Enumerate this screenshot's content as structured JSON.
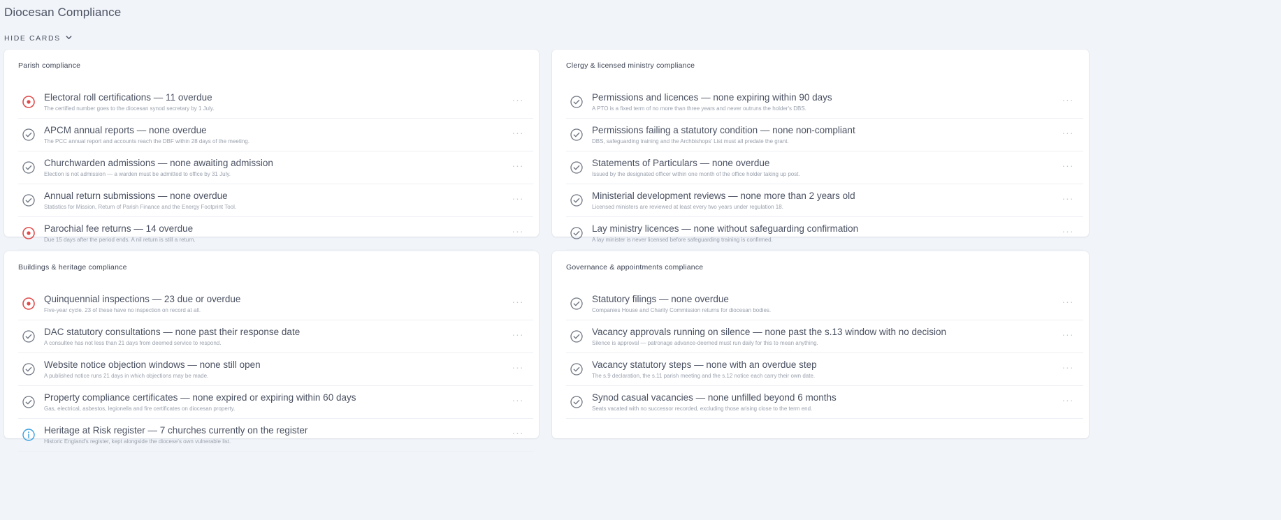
{
  "page": {
    "title": "Diocesan Compliance",
    "toggle_label": "HIDE CARDS",
    "toggle_icon": "chevron-down-icon"
  },
  "colors": {
    "background": "#f1f4f9",
    "card": "#ffffff",
    "status_overdue": "#e04a4a",
    "status_ok": "#6f7682",
    "status_info": "#3aa0e0"
  },
  "cards": [
    {
      "title": "Parish compliance",
      "rows": [
        {
          "status": "overdue",
          "icon": "alert-circle-icon",
          "title": "Electoral roll certifications — 11 overdue",
          "description": "The certified number goes to the diocesan synod secretary by 1 July."
        },
        {
          "status": "ok",
          "icon": "check-circle-icon",
          "title": "APCM annual reports — none overdue",
          "description": "The PCC annual report and accounts reach the DBF within 28 days of the meeting."
        },
        {
          "status": "ok",
          "icon": "check-circle-icon",
          "title": "Churchwarden admissions — none awaiting admission",
          "description": "Election is not admission — a warden must be admitted to office by 31 July."
        },
        {
          "status": "ok",
          "icon": "check-circle-icon",
          "title": "Annual return submissions — none overdue",
          "description": "Statistics for Mission, Return of Parish Finance and the Energy Footprint Tool."
        },
        {
          "status": "overdue",
          "icon": "alert-circle-icon",
          "title": "Parochial fee returns — 14 overdue",
          "description": "Due 15 days after the period ends. A nil return is still a return."
        }
      ]
    },
    {
      "title": "Clergy & licensed ministry compliance",
      "rows": [
        {
          "status": "ok",
          "icon": "check-circle-icon",
          "title": "Permissions and licences — none expiring within 90 days",
          "description": "A PTO is a fixed term of no more than three years and never outruns the holder's DBS."
        },
        {
          "status": "ok",
          "icon": "check-circle-icon",
          "title": "Permissions failing a statutory condition — none non-compliant",
          "description": "DBS, safeguarding training and the Archbishops' List must all predate the grant."
        },
        {
          "status": "ok",
          "icon": "check-circle-icon",
          "title": "Statements of Particulars — none overdue",
          "description": "Issued by the designated officer within one month of the office holder taking up post."
        },
        {
          "status": "ok",
          "icon": "check-circle-icon",
          "title": "Ministerial development reviews — none more than 2 years old",
          "description": "Licensed ministers are reviewed at least every two years under regulation 18."
        },
        {
          "status": "ok",
          "icon": "check-circle-icon",
          "title": "Lay ministry licences — none without safeguarding confirmation",
          "description": "A lay minister is never licensed before safeguarding training is confirmed."
        }
      ]
    },
    {
      "title": "Buildings & heritage compliance",
      "rows": [
        {
          "status": "overdue",
          "icon": "alert-circle-icon",
          "title": "Quinquennial inspections — 23 due or overdue",
          "description": "Five-year cycle. 23 of these have no inspection on record at all."
        },
        {
          "status": "ok",
          "icon": "check-circle-icon",
          "title": "DAC statutory consultations — none past their response date",
          "description": "A consultee has not less than 21 days from deemed service to respond."
        },
        {
          "status": "ok",
          "icon": "check-circle-icon",
          "title": "Website notice objection windows — none still open",
          "description": "A published notice runs 21 days in which objections may be made."
        },
        {
          "status": "ok",
          "icon": "check-circle-icon",
          "title": "Property compliance certificates — none expired or expiring within 60 days",
          "description": "Gas, electrical, asbestos, legionella and fire certificates on diocesan property."
        },
        {
          "status": "info",
          "icon": "info-circle-icon",
          "title": "Heritage at Risk register — 7 churches currently on the register",
          "description": "Historic England's register, kept alongside the diocese's own vulnerable list."
        }
      ]
    },
    {
      "title": "Governance & appointments compliance",
      "rows": [
        {
          "status": "ok",
          "icon": "check-circle-icon",
          "title": "Statutory filings — none overdue",
          "description": "Companies House and Charity Commission returns for diocesan bodies."
        },
        {
          "status": "ok",
          "icon": "check-circle-icon",
          "title": "Vacancy approvals running on silence — none past the s.13 window with no decision",
          "description": "Silence is approval — patronage advance-deemed must run daily for this to mean anything."
        },
        {
          "status": "ok",
          "icon": "check-circle-icon",
          "title": "Vacancy statutory steps — none with an overdue step",
          "description": "The s.9 declaration, the s.11 parish meeting and the s.12 notice each carry their own date."
        },
        {
          "status": "ok",
          "icon": "check-circle-icon",
          "title": "Synod casual vacancies — none unfilled beyond 6 months",
          "description": "Seats vacated with no successor recorded, excluding those arising close to the term end."
        }
      ]
    }
  ],
  "row_menu_glyph": "···"
}
